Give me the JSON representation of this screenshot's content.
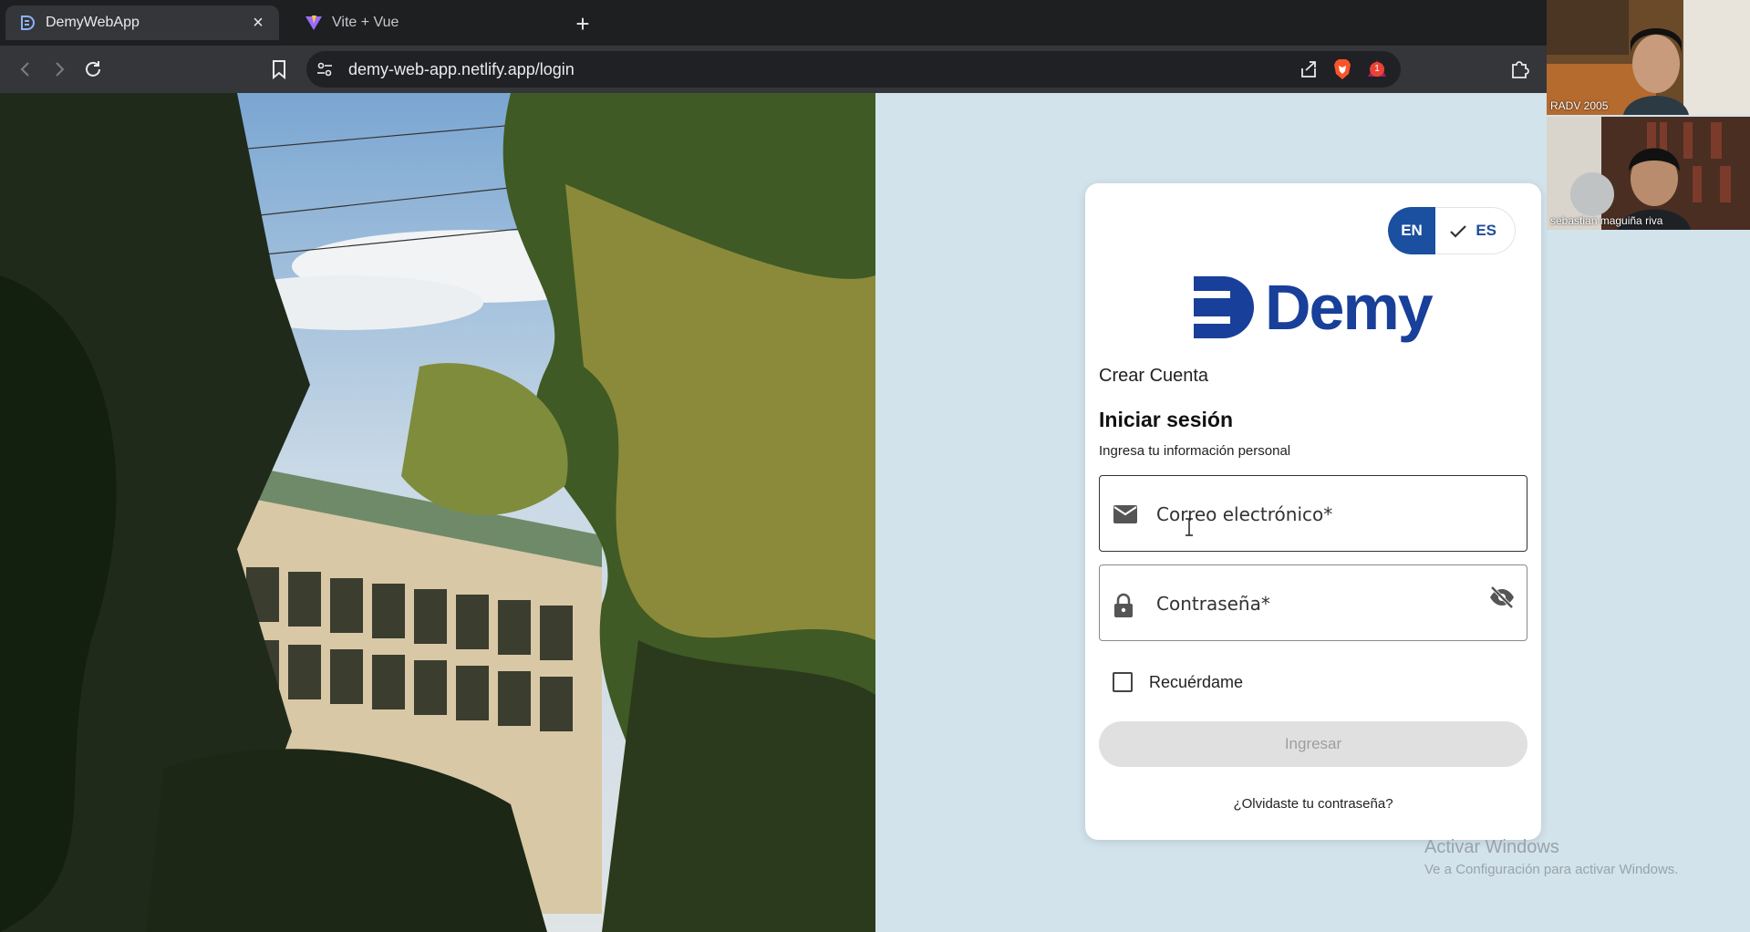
{
  "browser": {
    "tabs": [
      {
        "title": "DemyWebApp",
        "active": true
      },
      {
        "title": "Vite + Vue",
        "active": false
      }
    ],
    "url": "demy-web-app.netlify.app/login",
    "notification_count": "1"
  },
  "login": {
    "lang_en": "EN",
    "lang_es": "ES",
    "logo_text": "Demy",
    "create_account": "Crear Cuenta",
    "title": "Iniciar sesión",
    "subtitle": "Ingresa tu información personal",
    "email_placeholder": "Correo electrónico*",
    "password_placeholder": "Contraseña*",
    "remember_me": "Recuérdame",
    "submit": "Ingresar",
    "forgot_password": "¿Olvidaste tu contraseña?"
  },
  "windows_watermark": {
    "line1": "Activar Windows",
    "line2": "Ve a Configuración para activar Windows."
  },
  "video_call": {
    "participants": [
      "RADV 2005",
      "sebastian maguiña riva"
    ]
  },
  "colors": {
    "brand_blue": "#183f99",
    "lang_active": "#1b4fa0",
    "page_background": "#d2e3ec"
  }
}
